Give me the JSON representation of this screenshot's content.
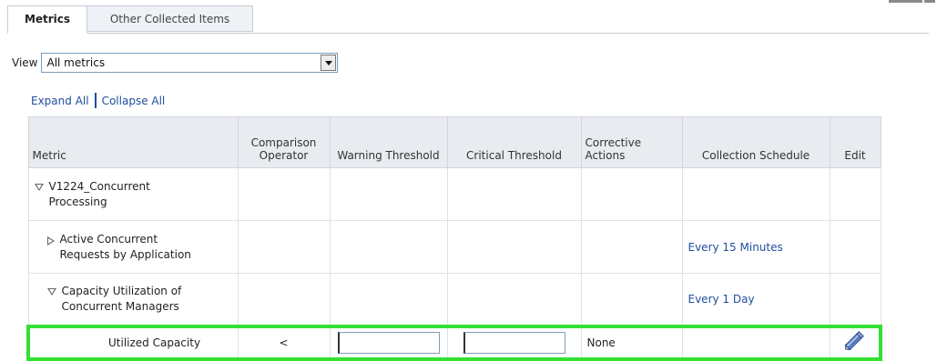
{
  "tabs": [
    {
      "label": "Metrics",
      "active": true
    },
    {
      "label": "Other Collected Items",
      "active": false
    }
  ],
  "view": {
    "label": "View",
    "selected": "All metrics"
  },
  "links": {
    "expand_all": "Expand All",
    "collapse_all": "Collapse All"
  },
  "table": {
    "headers": {
      "metric": "Metric",
      "comparison_line1": "Comparison",
      "comparison_line2": "Operator",
      "warning": "Warning Threshold",
      "critical": "Critical Threshold",
      "corrective_line1": "Corrective",
      "corrective_line2": "Actions",
      "schedule": "Collection Schedule",
      "edit": "Edit"
    },
    "rows": [
      {
        "name_line1": "V1224_Concurrent",
        "name_line2": "Processing",
        "expander": "expanded",
        "schedule": ""
      },
      {
        "name_line1": "Active Concurrent",
        "name_line2": "Requests by Application",
        "expander": "collapsed",
        "schedule": "Every 15 Minutes"
      },
      {
        "name_line1": "Capacity Utilization of",
        "name_line2": "Concurrent Managers",
        "expander": "expanded",
        "schedule": "Every 1 Day"
      },
      {
        "name": "Utilized Capacity",
        "operator": "<",
        "warning_value": "",
        "critical_value": "",
        "corrective": "None",
        "schedule": "",
        "highlighted": true
      }
    ]
  },
  "colors": {
    "highlight": "#33e033",
    "link": "#1f4e9c",
    "header_bg": "#e8ebef"
  },
  "icons": {
    "edit": "pencil-icon",
    "dropdown": "chevron-down-icon",
    "expanded": "triangle-down-icon",
    "collapsed": "triangle-right-icon"
  }
}
